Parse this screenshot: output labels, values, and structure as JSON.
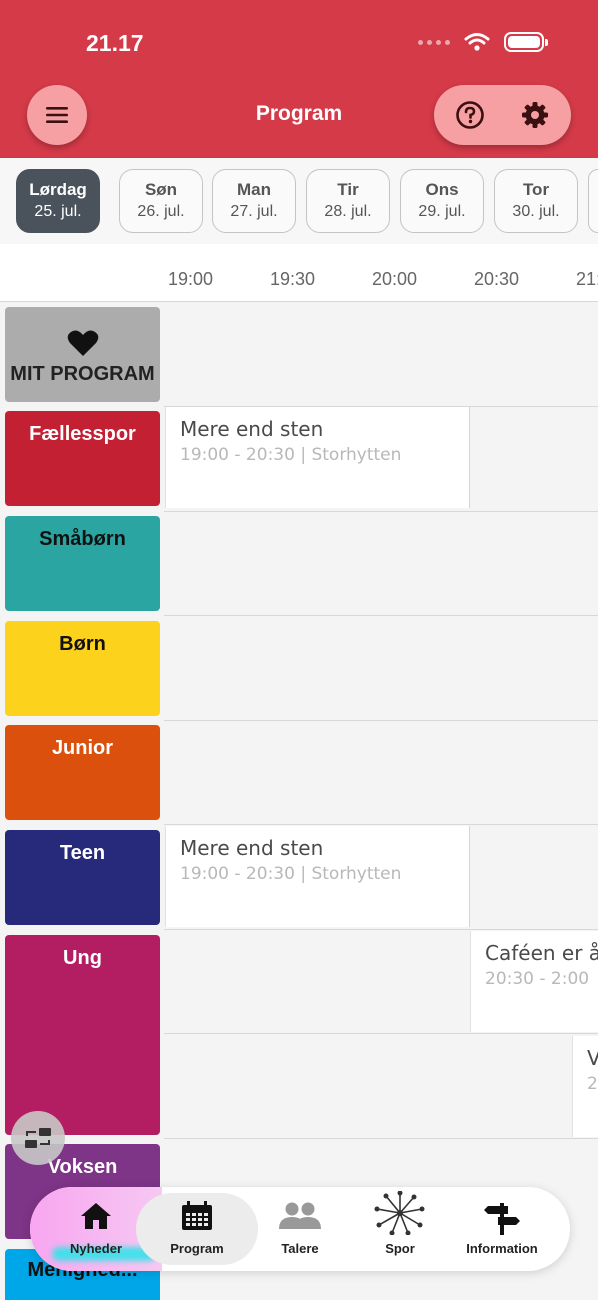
{
  "status_bar": {
    "time": "21.17"
  },
  "header": {
    "title": "Program"
  },
  "dates": [
    {
      "day": "Lørdag",
      "date": "25. jul.",
      "active": true
    },
    {
      "day": "Søn",
      "date": "26. jul.",
      "active": false
    },
    {
      "day": "Man",
      "date": "27. jul.",
      "active": false
    },
    {
      "day": "Tir",
      "date": "28. jul.",
      "active": false
    },
    {
      "day": "Ons",
      "date": "29. jul.",
      "active": false
    },
    {
      "day": "Tor",
      "date": "30. jul.",
      "active": false
    }
  ],
  "timeline": {
    "times": [
      "19:00",
      "19:30",
      "20:00",
      "20:30",
      "21:"
    ]
  },
  "tracks": [
    {
      "label": "MIT PROGRAM",
      "color": "#acacac",
      "text_color": "#222222"
    },
    {
      "label": "Fællesspor",
      "color": "#c42034",
      "text_color": "#ffffff"
    },
    {
      "label": "Småbørn",
      "color": "#2aa5a2",
      "text_color": "#111111"
    },
    {
      "label": "Børn",
      "color": "#fdd21d",
      "text_color": "#111111"
    },
    {
      "label": "Junior",
      "color": "#da500c",
      "text_color": "#ffffff"
    },
    {
      "label": "Teen",
      "color": "#272a7a",
      "text_color": "#ffffff"
    },
    {
      "label": "Ung",
      "color": "#b31e62",
      "text_color": "#ffffff"
    },
    {
      "label": "Voksen",
      "color": "#7e3487",
      "text_color": "#ffffff"
    },
    {
      "label": "Menighed...",
      "color": "#00a7e8",
      "text_color": "#111111"
    }
  ],
  "events": [
    {
      "title": "Mere end sten",
      "meta": "19:00 - 20:30 | Storhytten"
    },
    {
      "title": "Mere end sten",
      "meta": "19:00 - 20:30 | Storhytten"
    },
    {
      "title": "Caféen er å",
      "meta": "20:30 - 2:00"
    },
    {
      "title": "V",
      "meta": "2"
    }
  ],
  "nav": {
    "home": "Nyheder",
    "program": "Program",
    "speakers": "Talere",
    "tracks": "Spor",
    "info": "Information"
  },
  "colors": {
    "header": "#d43a48",
    "pill": "#f6a0a3",
    "active_date": "#4a535c",
    "home_glow": "#33e3e8"
  }
}
